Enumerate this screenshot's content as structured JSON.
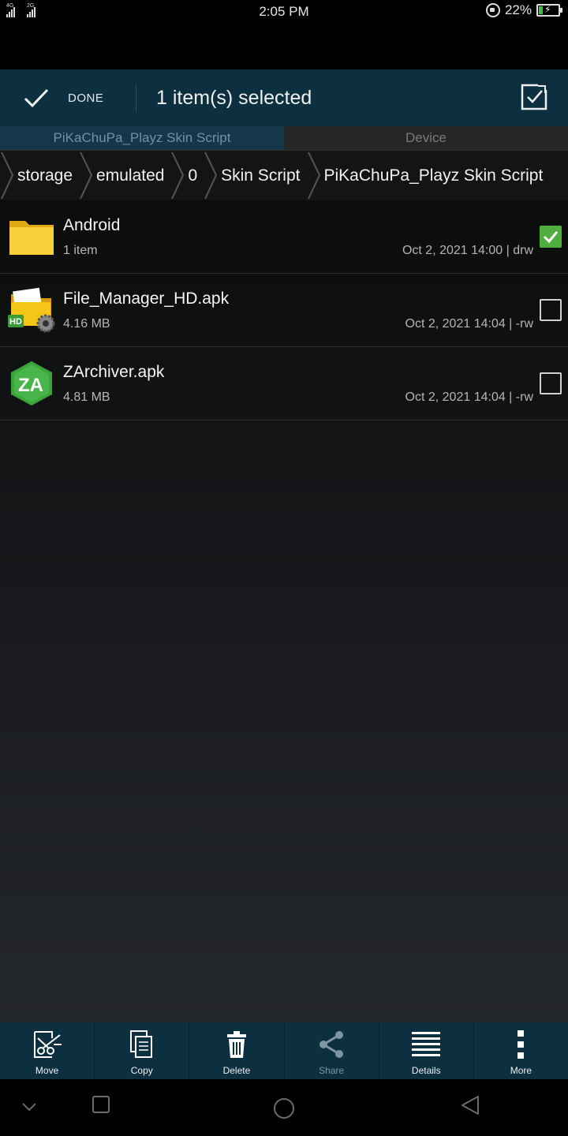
{
  "status_bar": {
    "network1": "4G",
    "network2": "2G",
    "time": "2:05 PM",
    "battery": "22%",
    "battery_level": 0.22
  },
  "toolbar": {
    "done_label": "DONE",
    "title": "1 item(s) selected"
  },
  "tabs": [
    {
      "label": "PiKaChuPa_Playz Skin Script",
      "active": true
    },
    {
      "label": "Device",
      "active": false
    }
  ],
  "breadcrumb": [
    "storage",
    "emulated",
    "0",
    "Skin Script",
    "PiKaChuPa_Playz Skin Script"
  ],
  "files": [
    {
      "name": "Android",
      "meta": "1 item",
      "date": "Oct 2, 2021 14:00 | drw",
      "icon": "folder-icon",
      "checked": true
    },
    {
      "name": "File_Manager_HD.apk",
      "meta": "4.16 MB",
      "date": "Oct 2, 2021 14:04 | -rw",
      "icon": "file-manager-hd-app-icon",
      "checked": false
    },
    {
      "name": "ZArchiver.apk",
      "meta": "4.81 MB",
      "date": "Oct 2, 2021 14:04 | -rw",
      "icon": "zarchiver-app-icon",
      "checked": false
    }
  ],
  "actions": [
    {
      "label": "Move",
      "icon": "move-icon"
    },
    {
      "label": "Copy",
      "icon": "copy-icon"
    },
    {
      "label": "Delete",
      "icon": "delete-icon"
    },
    {
      "label": "Share",
      "icon": "share-icon",
      "disabled": true
    },
    {
      "label": "Details",
      "icon": "details-icon"
    },
    {
      "label": "More",
      "icon": "more-icon"
    }
  ],
  "colors": {
    "header": "#0c3040",
    "check_green": "#4fae3d",
    "folder": "#f5c518"
  }
}
